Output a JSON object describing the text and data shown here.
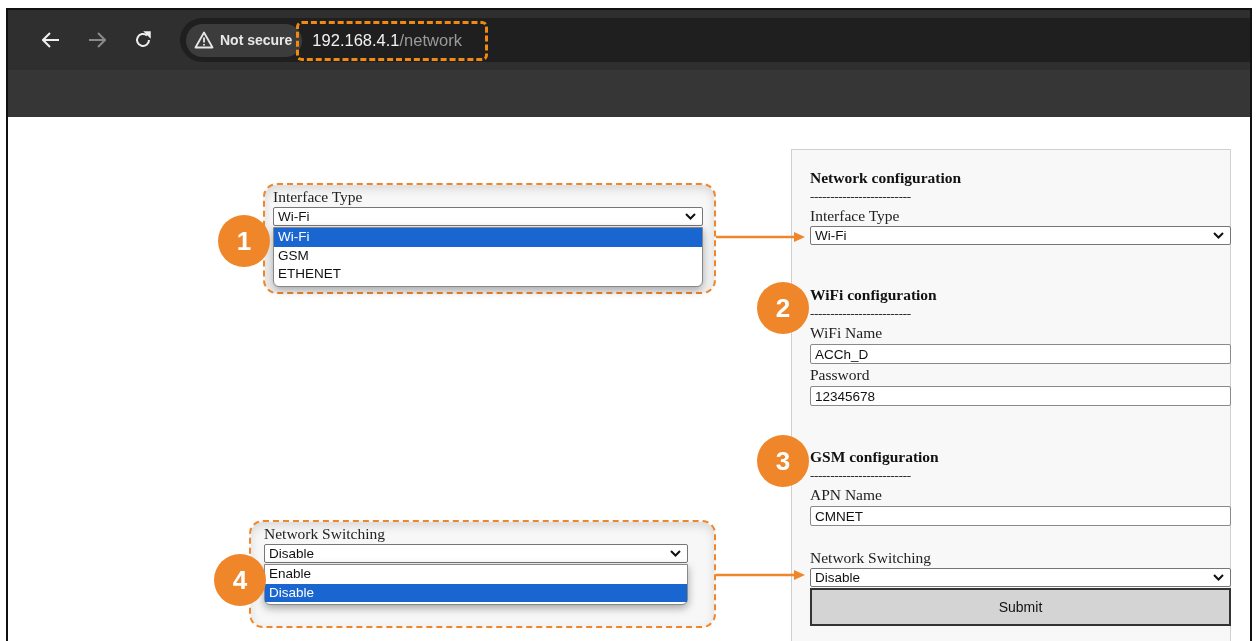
{
  "browser": {
    "back_disabled": false,
    "forward_disabled": true,
    "security": "Not secure",
    "url_host": "192.168.4.1",
    "url_path": "/network"
  },
  "callouts": [
    {
      "badge": "1",
      "label": "Interface Type",
      "value": "Wi-Fi",
      "options": [
        {
          "label": "Wi-Fi",
          "selected": true
        },
        {
          "label": "GSM",
          "selected": false
        },
        {
          "label": "ETHENET",
          "selected": false
        }
      ]
    },
    {
      "badge": "4",
      "label": "Network Switching",
      "value": "Disable",
      "options": [
        {
          "label": "Enable",
          "selected": false
        },
        {
          "label": "Disable",
          "selected": true
        }
      ]
    }
  ],
  "form": {
    "sections": [
      {
        "title": "Network configuration",
        "rule": "-------------------------",
        "fields": [
          {
            "kind": "select",
            "label": "Interface Type",
            "value": "Wi-Fi"
          }
        ]
      },
      {
        "badge": "2",
        "title": "WiFi configuration",
        "rule": "-------------------------",
        "fields": [
          {
            "kind": "text",
            "label": "WiFi Name",
            "value": "ACCh_D"
          },
          {
            "kind": "text",
            "label": "Password",
            "value": "12345678"
          }
        ]
      },
      {
        "badge": "3",
        "title": "GSM configuration",
        "rule": "-------------------------",
        "fields": [
          {
            "kind": "text",
            "label": "APN Name",
            "value": "CMNET"
          },
          {
            "kind": "select",
            "label": "Network Switching",
            "value": "Disable"
          }
        ]
      }
    ],
    "submit": "Submit"
  }
}
